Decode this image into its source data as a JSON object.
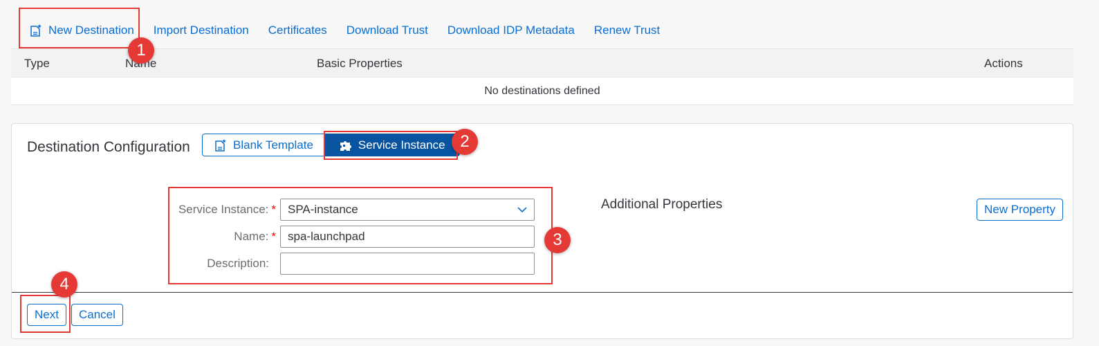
{
  "toolbar": {
    "new_destination": "New Destination",
    "import_destination": "Import Destination",
    "certificates": "Certificates",
    "download_trust": "Download Trust",
    "download_idp_metadata": "Download IDP Metadata",
    "renew_trust": "Renew Trust"
  },
  "table": {
    "columns": [
      "Type",
      "Name",
      "Basic Properties",
      "Actions"
    ],
    "empty_text": "No destinations defined"
  },
  "config": {
    "title": "Destination Configuration",
    "blank_template": "Blank Template",
    "service_instance": "Service Instance",
    "fields": {
      "service_instance_label": "Service Instance:",
      "service_instance_value": "SPA-instance",
      "name_label": "Name:",
      "name_value": "spa-launchpad",
      "description_label": "Description:",
      "description_value": ""
    },
    "required_mark": "*",
    "additional_properties": "Additional Properties",
    "new_property": "New Property",
    "next": "Next",
    "cancel": "Cancel"
  },
  "annotations": [
    "1",
    "2",
    "3",
    "4"
  ],
  "colors": {
    "accent": "#0a6ed1",
    "active": "#0854a0",
    "highlight": "#e53935"
  }
}
